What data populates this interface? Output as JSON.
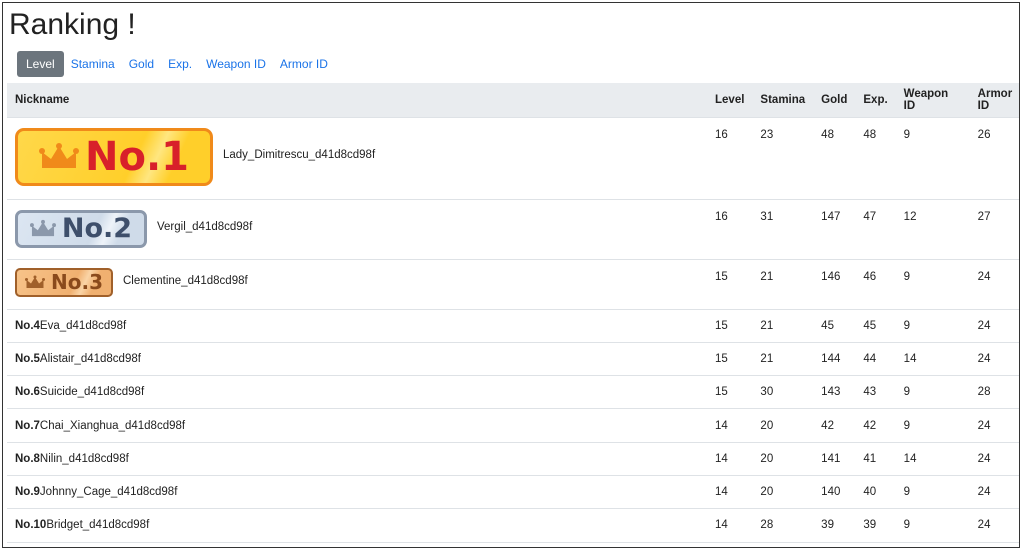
{
  "page": {
    "title": "Ranking !"
  },
  "tabs": [
    {
      "label": "Level",
      "active": true
    },
    {
      "label": "Stamina"
    },
    {
      "label": "Gold"
    },
    {
      "label": "Exp."
    },
    {
      "label": "Weapon ID"
    },
    {
      "label": "Armor ID"
    }
  ],
  "table": {
    "headers": {
      "nickname": "Nickname",
      "level": "Level",
      "stamina": "Stamina",
      "gold": "Gold",
      "exp": "Exp.",
      "weapon": "Weapon ID",
      "armor": "Armor ID"
    },
    "badges": {
      "first": "No.1",
      "second": "No.2",
      "third": "No.3"
    },
    "rows": [
      {
        "rank": "No.1",
        "nickname": "Lady_Dimitrescu_d41d8cd98f",
        "level": "16",
        "stamina": "23",
        "gold": "48",
        "exp": "48",
        "weapon": "9",
        "armor": "26"
      },
      {
        "rank": "No.2",
        "nickname": "Vergil_d41d8cd98f",
        "level": "16",
        "stamina": "31",
        "gold": "147",
        "exp": "47",
        "weapon": "12",
        "armor": "27"
      },
      {
        "rank": "No.3",
        "nickname": "Clementine_d41d8cd98f",
        "level": "15",
        "stamina": "21",
        "gold": "146",
        "exp": "46",
        "weapon": "9",
        "armor": "24"
      },
      {
        "rank": "No.4",
        "nickname": "Eva_d41d8cd98f",
        "level": "15",
        "stamina": "21",
        "gold": "45",
        "exp": "45",
        "weapon": "9",
        "armor": "24"
      },
      {
        "rank": "No.5",
        "nickname": "Alistair_d41d8cd98f",
        "level": "15",
        "stamina": "21",
        "gold": "144",
        "exp": "44",
        "weapon": "14",
        "armor": "24"
      },
      {
        "rank": "No.6",
        "nickname": "Suicide_d41d8cd98f",
        "level": "15",
        "stamina": "30",
        "gold": "143",
        "exp": "43",
        "weapon": "9",
        "armor": "28"
      },
      {
        "rank": "No.7",
        "nickname": "Chai_Xianghua_d41d8cd98f",
        "level": "14",
        "stamina": "20",
        "gold": "42",
        "exp": "42",
        "weapon": "9",
        "armor": "24"
      },
      {
        "rank": "No.8",
        "nickname": "Nilin_d41d8cd98f",
        "level": "14",
        "stamina": "20",
        "gold": "141",
        "exp": "41",
        "weapon": "14",
        "armor": "24"
      },
      {
        "rank": "No.9",
        "nickname": "Johnny_Cage_d41d8cd98f",
        "level": "14",
        "stamina": "20",
        "gold": "140",
        "exp": "40",
        "weapon": "9",
        "armor": "24"
      },
      {
        "rank": "No.10",
        "nickname": "Bridget_d41d8cd98f",
        "level": "14",
        "stamina": "28",
        "gold": "39",
        "exp": "39",
        "weapon": "9",
        "armor": "24"
      }
    ]
  },
  "colors": {
    "gold_badge": "#ffd84a",
    "silver_badge": "#cfdbe9",
    "bronze_badge": "#f0b070",
    "active_tab": "#6c757d",
    "link": "#1a73e8"
  }
}
